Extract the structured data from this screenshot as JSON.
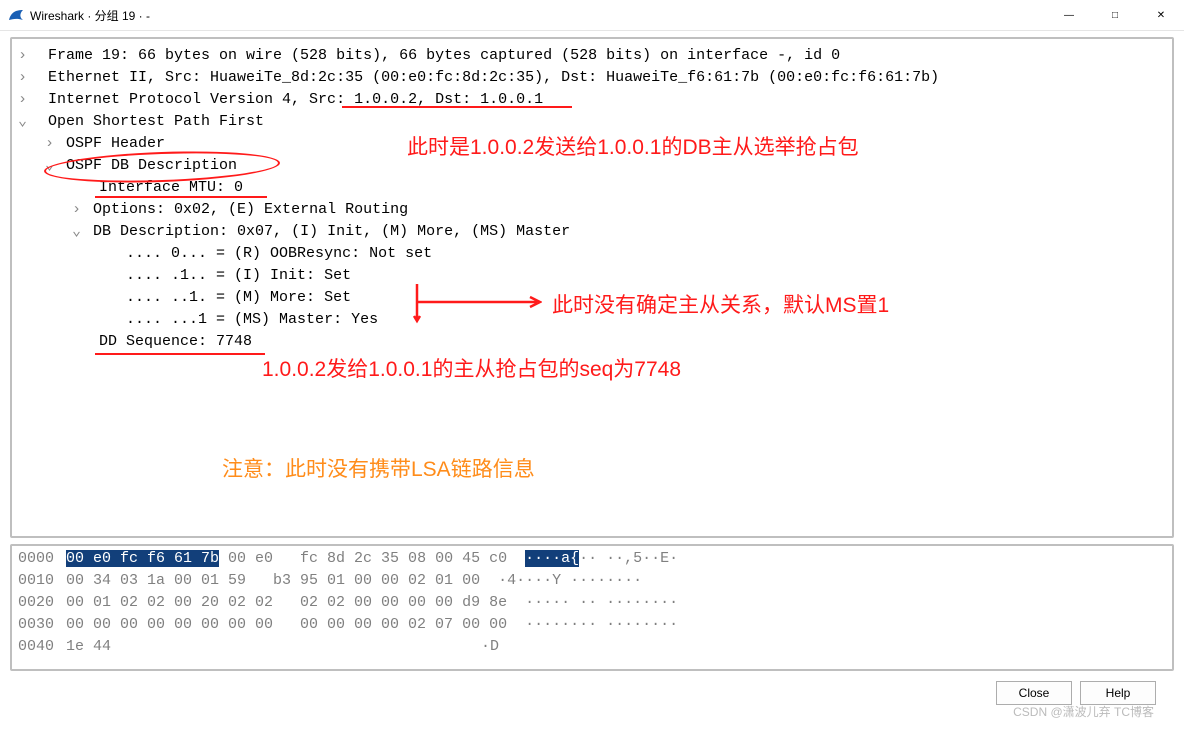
{
  "window": {
    "title": "Wireshark · 分组 19 · -"
  },
  "tree": {
    "l1": "Frame 19: 66 bytes on wire (528 bits), 66 bytes captured (528 bits) on interface -, id 0",
    "l2": "Ethernet II, Src: HuaweiTe_8d:2c:35 (00:e0:fc:8d:2c:35), Dst: HuaweiTe_f6:61:7b (00:e0:fc:f6:61:7b)",
    "l3": "Internet Protocol Version 4, Src: 1.0.0.2, Dst: 1.0.0.1",
    "l4": "Open Shortest Path First",
    "l5": "OSPF Header",
    "l6": "OSPF DB Description",
    "l7": "Interface MTU: 0",
    "l8": "Options: 0x02, (E) External Routing",
    "l9": "DB Description: 0x07, (I) Init, (M) More, (MS) Master",
    "l10": ".... 0... = (R) OOBResync: Not set",
    "l11": ".... .1.. = (I) Init: Set",
    "l12": ".... ..1. = (M) More: Set",
    "l13": ".... ...1 = (MS) Master: Yes",
    "l14": "DD Sequence: 7748"
  },
  "hex": {
    "r0": {
      "off": "0000",
      "h1": "00 e0 fc f6 61 7b",
      "h2": " 00 e0   fc 8d 2c 35 08 00 45 c0",
      "a1": "····a{",
      "a2": "·· ··,5··E·"
    },
    "r1": {
      "off": "0010",
      "h": "00 34 03 1a 00 01 59   b3 95 01 00 00 02 01 00",
      "a": "·4····Y ········"
    },
    "r2": {
      "off": "0020",
      "h": "00 01 02 02 00 20 02 02   02 02 00 00 00 00 d9 8e",
      "a": "····· ·· ········"
    },
    "r3": {
      "off": "0030",
      "h": "00 00 00 00 00 00 00 00   00 00 00 00 02 07 00 00",
      "a": "········ ········"
    },
    "r4": {
      "off": "0040",
      "h": "1e 44",
      "a": "·D"
    }
  },
  "annotations": {
    "a1": "此时是1.0.0.2发送给1.0.0.1的DB主从选举抢占包",
    "a2": "此时没有确定主从关系，默认MS置1",
    "a3": "1.0.0.2发给1.0.0.1的主从抢占包的seq为7748",
    "a4": "注意：此时没有携带LSA链路信息"
  },
  "buttons": {
    "close": "Close",
    "help": "Help"
  },
  "watermark": "CSDN @潇波儿弃 TC博客"
}
